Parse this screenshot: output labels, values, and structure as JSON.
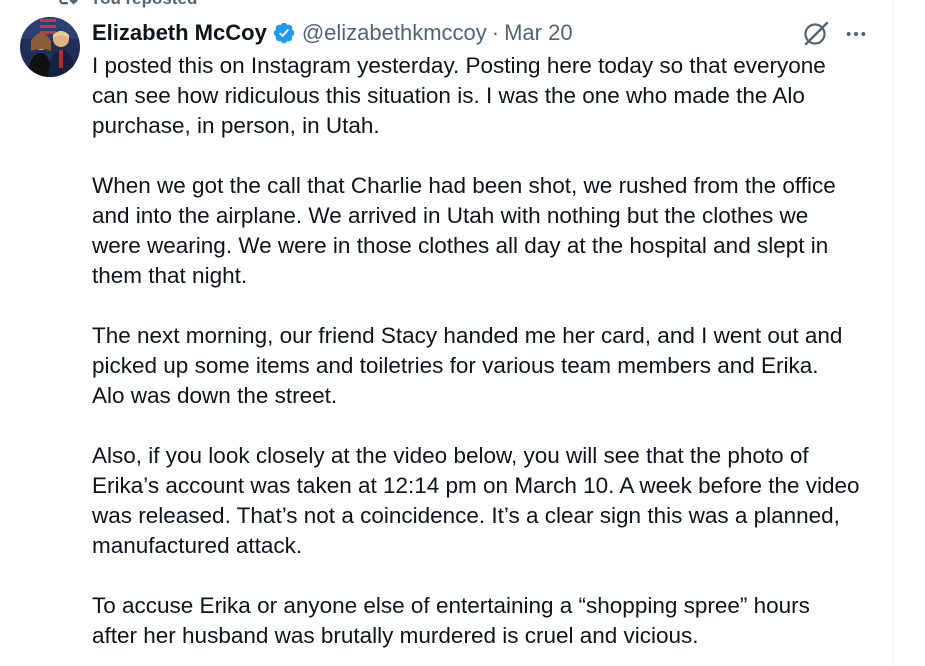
{
  "repost": {
    "label": "You reposted",
    "icon": "repost-icon"
  },
  "tweet": {
    "author": {
      "name": "Elizabeth McCoy",
      "handle": "@elizabethkmccoy",
      "verified": true,
      "verified_color": "#1d9bf0"
    },
    "separator": "·",
    "date": "Mar 20",
    "actions": {
      "grok_icon": "grok-icon",
      "more_icon": "more-icon"
    },
    "paragraphs": [
      "I posted this on Instagram yesterday. Posting here today so that everyone\ncan see how ridiculous this situation is. I was the one who made the Alo\npurchase, in person, in Utah.",
      "When we got the call that Charlie had been shot, we rushed from the office\nand into the airplane. We arrived in Utah with nothing but the clothes we\nwere wearing. We were in those clothes all day at the hospital and slept in\nthem that night.",
      "The next morning, our friend Stacy handed me her card, and I went out and\npicked up some items and toiletries for various team members and Erika.\nAlo was down the street.",
      "Also, if you look closely at the video below, you will see that the photo of\nErika’s account was taken at 12:14 pm on March 10. A week before the video\nwas released. That’s not a coincidence. It’s a clear sign this was a planned,\nmanufactured attack.",
      "To accuse Erika or anyone else of entertaining a “shopping spree” hours\nafter her husband was brutally murdered is cruel and vicious."
    ]
  },
  "colors": {
    "text_primary": "#0f1419",
    "text_secondary": "#536471",
    "border": "#eff3f4"
  }
}
